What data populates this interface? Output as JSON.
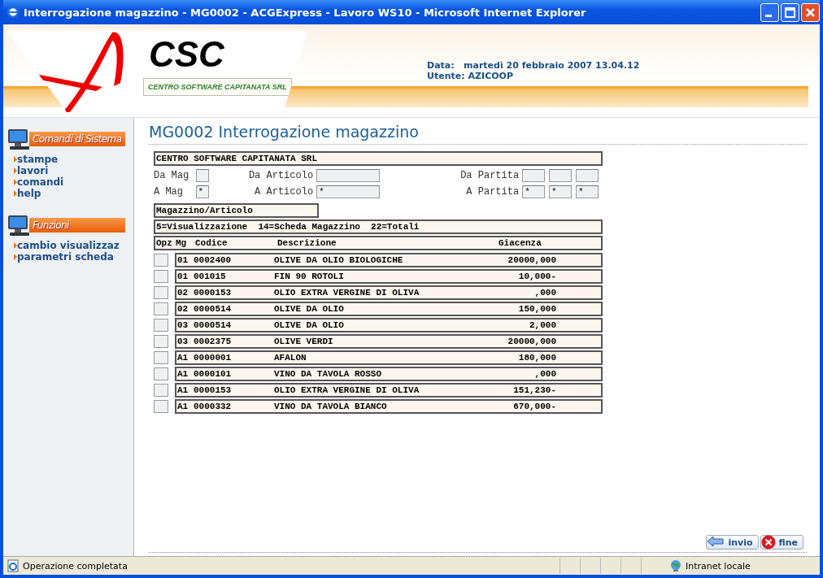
{
  "window": {
    "title": "Interrogazione magazzino - MG0002 - ACGExpress - Lavoro WS10 - Microsoft Internet Explorer"
  },
  "header": {
    "logo_text": "CSC",
    "logo_subtitle": "CENTRO SOFTWARE CAPITANATA SRL",
    "data_label": "Data:",
    "data_value": "martedì 20 febbraio 2007 13.04.12",
    "utente_label": "Utente:",
    "utente_value": "AZICOOP"
  },
  "sidebar": [
    {
      "title": "Comandi di Sistema",
      "items": [
        "stampe",
        "lavori",
        "comandi",
        "help"
      ]
    },
    {
      "title": "Funzioni",
      "items": [
        "cambio visualizzaz",
        "parametri scheda"
      ]
    }
  ],
  "page_title": "MG0002 Interrogazione magazzino",
  "company": "CENTRO SOFTWARE CAPITANATA SRL",
  "filters": [
    {
      "mag_label": "Da Mag",
      "mag": {
        "kind": "short"
      },
      "art_label": "Da Articolo",
      "art": {
        "kind": "long"
      },
      "partita_label": "Da Partita",
      "partita": [
        {
          "kind": "medium"
        },
        {
          "kind": "medium"
        },
        {
          "kind": "medium"
        }
      ]
    },
    {
      "mag_label": "A Mag",
      "mag": {
        "kind": "short",
        "value": "*"
      },
      "art_label": "A Articolo",
      "art": {
        "kind": "long",
        "value": "*"
      },
      "partita_label": "A Partita",
      "partita": [
        {
          "kind": "medium",
          "value": "*"
        },
        {
          "kind": "medium",
          "value": "*"
        },
        {
          "kind": "medium",
          "value": "*"
        }
      ]
    }
  ],
  "view_label": "Magazzino/Articolo",
  "options": "5=Visualizzazione  14=Scheda Magazzino  22=Totali",
  "columns": [
    "Opz",
    "Mg",
    "Codice",
    "Descrizione",
    "Giacenza"
  ],
  "rows": [
    {
      "mg": "01",
      "codice": "0002400",
      "descrizione": "OLIVE DA OLIO BIOLOGICHE",
      "giacenza": "20000,000"
    },
    {
      "mg": "01",
      "codice": "001015",
      "descrizione": "FIN 90 ROTOLI",
      "giacenza": "10,000-"
    },
    {
      "mg": "02",
      "codice": "0000153",
      "descrizione": "OLIO EXTRA VERGINE DI OLIVA",
      "giacenza": ",000"
    },
    {
      "mg": "02",
      "codice": "0000514",
      "descrizione": "OLIVE DA OLIO",
      "giacenza": "150,000"
    },
    {
      "mg": "03",
      "codice": "0000514",
      "descrizione": "OLIVE DA OLIO",
      "giacenza": "2,000"
    },
    {
      "mg": "03",
      "codice": "0002375",
      "descrizione": "OLIVE VERDI",
      "giacenza": "20000,000"
    },
    {
      "mg": "A1",
      "codice": "0000001",
      "descrizione": "AFALON",
      "giacenza": "180,000"
    },
    {
      "mg": "A1",
      "codice": "0000101",
      "descrizione": "VINO DA TAVOLA ROSSO",
      "giacenza": ",000"
    },
    {
      "mg": "A1",
      "codice": "0000153",
      "descrizione": "OLIO EXTRA VERGINE DI OLIVA",
      "giacenza": "151,230-"
    },
    {
      "mg": "A1",
      "codice": "0000332",
      "descrizione": "VINO DA TAVOLA BIANCO",
      "giacenza": "670,000-"
    }
  ],
  "buttons": [
    {
      "label": "invio",
      "kind": "send"
    },
    {
      "label": "fine",
      "kind": "close"
    }
  ],
  "status_bar": {
    "message": "Operazione completata",
    "zone": "Intranet locale"
  }
}
